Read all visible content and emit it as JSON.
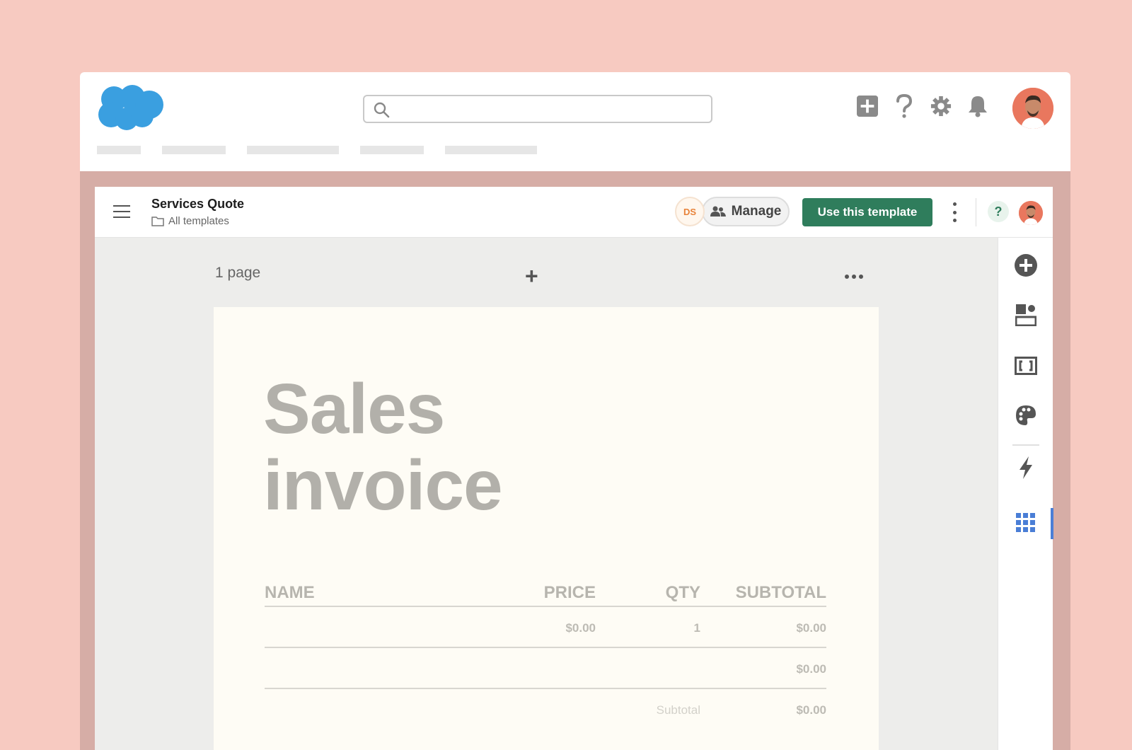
{
  "header": {
    "search_placeholder": "",
    "icons": [
      "add-icon",
      "help-icon",
      "gear-icon",
      "bell-icon"
    ]
  },
  "app": {
    "title": "Services Quote",
    "breadcrumb": "All templates",
    "initials": "DS",
    "manage_label": "Manage",
    "use_template_label": "Use this template",
    "help_label": "?"
  },
  "canvas": {
    "page_count": "1 page",
    "add_label": "+"
  },
  "document": {
    "heading_line1": "Sales",
    "heading_line2": "invoice",
    "columns": {
      "name": "NAME",
      "price": "PRICE",
      "qty": "QTY",
      "subtotal": "SUBTOTAL"
    },
    "rows": [
      {
        "price": "$0.00",
        "qty": "1",
        "subtotal": "$0.00"
      },
      {
        "subtotal": "$0.00"
      }
    ],
    "subtotal_label": "Subtotal",
    "subtotal_value": "$0.00"
  },
  "colors": {
    "accent_green": "#2f7d5c",
    "salesforce_blue": "#3a9fe0",
    "active_blue": "#4a7ed6",
    "background": "#f7cac1"
  },
  "rail_icons": [
    "add-circle-icon",
    "layout-blocks-icon",
    "fields-icon",
    "palette-icon",
    "lightning-icon",
    "apps-grid-icon"
  ]
}
